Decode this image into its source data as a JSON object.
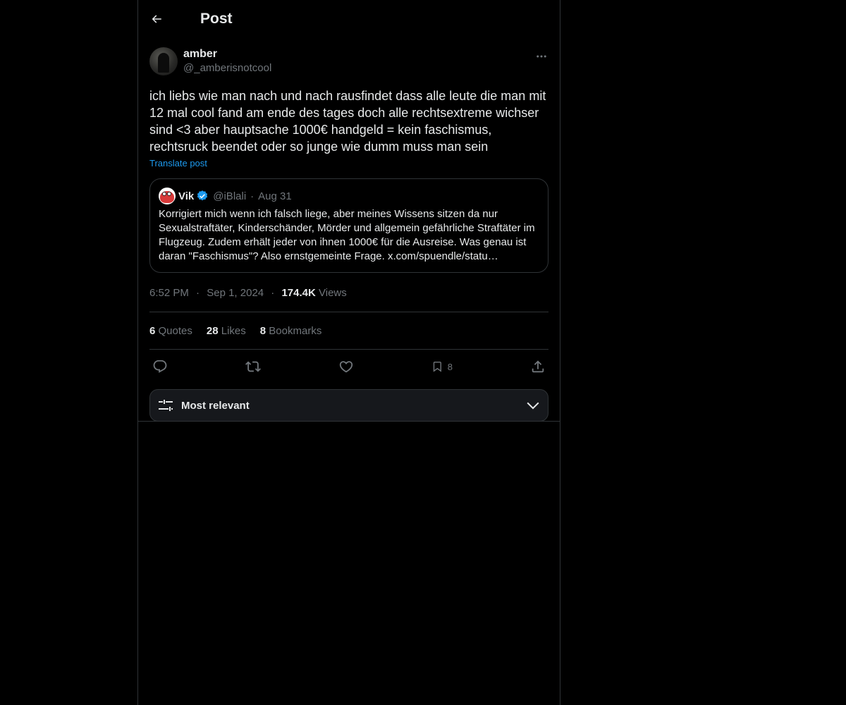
{
  "header": {
    "title": "Post"
  },
  "post": {
    "author_name": "amber",
    "author_handle": "@_amberisnotcool",
    "text": "ich liebs wie man nach und nach rausfindet dass alle leute die man mit 12 mal cool fand am ende des tages doch alle rechtsextreme wichser sind <3 aber hauptsache 1000€ handgeld = kein faschismus, rechtsruck beendet oder so junge wie dumm muss man sein",
    "translate_label": "Translate post",
    "time": "6:52 PM",
    "date": "Sep 1, 2024",
    "views_count": "174.4K",
    "views_label": "Views"
  },
  "quote": {
    "name": "Vik",
    "handle": "@iBlali",
    "date": "Aug 31",
    "text": "Korrigiert mich wenn ich falsch liege, aber meines Wissens sitzen da nur Sexualstraftäter, Kinderschänder, Mörder und allgemein gefährliche Straftäter im Flugzeug. Zudem erhält jeder von ihnen 1000€ für die Ausreise. Was genau ist daran \"Faschismus\"? Also ernstgemeinte Frage. x.com/spuendle/statu…"
  },
  "stats": {
    "quotes_count": "6",
    "quotes_label": "Quotes",
    "likes_count": "28",
    "likes_label": "Likes",
    "bookmarks_count": "8",
    "bookmarks_label": "Bookmarks"
  },
  "actions": {
    "bookmark_count": "8"
  },
  "sort": {
    "label": "Most relevant"
  },
  "colors": {
    "accent": "#1d9bf0",
    "background": "#000000",
    "border": "#2f3336",
    "muted": "#71767b"
  },
  "icons": [
    "back-arrow-icon",
    "more-icon",
    "verified-icon",
    "reply-icon",
    "repost-icon",
    "like-icon",
    "bookmark-icon",
    "share-icon",
    "sliders-icon",
    "chevron-down-icon"
  ]
}
